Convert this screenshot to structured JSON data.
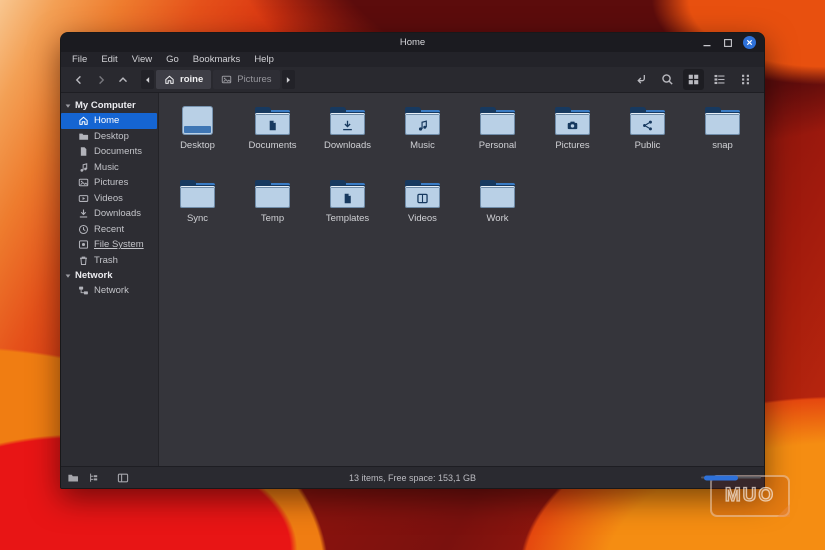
{
  "titlebar": {
    "title": "Home",
    "controls": [
      {
        "name": "minimize",
        "icon": "minimize-icon"
      },
      {
        "name": "maximize",
        "icon": "maximize-icon"
      },
      {
        "name": "close",
        "icon": "close-icon"
      }
    ]
  },
  "menubar": {
    "items": [
      "File",
      "Edit",
      "View",
      "Go",
      "Bookmarks",
      "Help"
    ]
  },
  "toolbar": {
    "nav": [
      {
        "name": "back",
        "icon": "chevron-left-icon"
      },
      {
        "name": "forward",
        "icon": "chevron-right-icon",
        "dim": true
      },
      {
        "name": "up",
        "icon": "chevron-up-icon"
      }
    ],
    "path_scroll_left_icon": "triangle-left-icon",
    "path_scroll_right_icon": "triangle-right-icon",
    "path_segments": [
      {
        "label": "roine",
        "icon": "home-icon",
        "active": true
      },
      {
        "label": "Pictures",
        "icon": "image-icon",
        "active": false
      }
    ],
    "right_buttons": [
      {
        "name": "jump-to-path",
        "icon": "jump-icon",
        "active": false
      },
      {
        "name": "search",
        "icon": "search-icon",
        "active": false
      },
      {
        "name": "icon-view",
        "icon": "icon-view-icon",
        "active": true
      },
      {
        "name": "list-view",
        "icon": "list-view-icon",
        "active": false
      },
      {
        "name": "compact-view",
        "icon": "compact-view-icon",
        "active": false
      }
    ]
  },
  "sidebar": {
    "sections": [
      {
        "header": "My Computer",
        "items": [
          {
            "label": "Home",
            "icon": "home-icon",
            "selected": true
          },
          {
            "label": "Desktop",
            "icon": "folder-icon"
          },
          {
            "label": "Documents",
            "icon": "document-icon"
          },
          {
            "label": "Music",
            "icon": "music-icon"
          },
          {
            "label": "Pictures",
            "icon": "image-icon"
          },
          {
            "label": "Videos",
            "icon": "video-icon"
          },
          {
            "label": "Downloads",
            "icon": "download-icon"
          },
          {
            "label": "Recent",
            "icon": "clock-icon"
          },
          {
            "label": "File System",
            "icon": "drive-icon",
            "underlined": true
          },
          {
            "label": "Trash",
            "icon": "trash-icon"
          }
        ]
      },
      {
        "header": "Network",
        "items": [
          {
            "label": "Network",
            "icon": "network-icon"
          }
        ]
      }
    ]
  },
  "files": [
    {
      "name": "Desktop",
      "emblem": "desktop"
    },
    {
      "name": "Documents",
      "emblem": "page"
    },
    {
      "name": "Downloads",
      "emblem": "download"
    },
    {
      "name": "Music",
      "emblem": "music"
    },
    {
      "name": "Personal",
      "emblem": "none"
    },
    {
      "name": "Pictures",
      "emblem": "camera"
    },
    {
      "name": "Public",
      "emblem": "share"
    },
    {
      "name": "snap",
      "emblem": "none"
    },
    {
      "name": "Sync",
      "emblem": "none"
    },
    {
      "name": "Temp",
      "emblem": "none"
    },
    {
      "name": "Templates",
      "emblem": "page"
    },
    {
      "name": "Videos",
      "emblem": "film"
    },
    {
      "name": "Work",
      "emblem": "none"
    }
  ],
  "statusbar": {
    "summary": "13 items, Free space: 153,1 GB",
    "icons": [
      {
        "name": "places-pane",
        "icon": "folder-pane-icon"
      },
      {
        "name": "directory-tree",
        "icon": "tree-icon"
      },
      {
        "name": "side-pane-toggle",
        "icon": "panel-icon",
        "gap": true
      }
    ]
  },
  "watermark": {
    "text": "MUO"
  },
  "colors": {
    "accent_blue": "#1565d2",
    "close_button_blue": "#2e71d9",
    "folder_front": "#b9d0e6",
    "folder_back": "#17395f",
    "folder_accent": "#3b7cc4",
    "titlebar_bg": "#1b1b20",
    "window_bg": "#35353b"
  }
}
